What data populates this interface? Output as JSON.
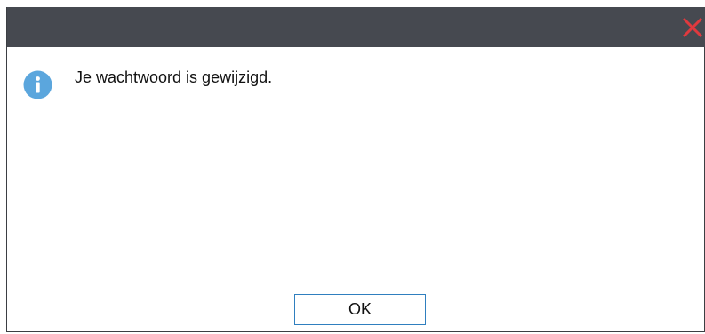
{
  "dialog": {
    "message": "Je wachtwoord is gewijzigd.",
    "ok_label": "OK",
    "icon": "info-icon",
    "close_icon": "close-icon"
  },
  "colors": {
    "titlebar": "#464950",
    "close": "#e0393e",
    "info": "#5ba6dd",
    "button_border": "#2f7fbf"
  }
}
